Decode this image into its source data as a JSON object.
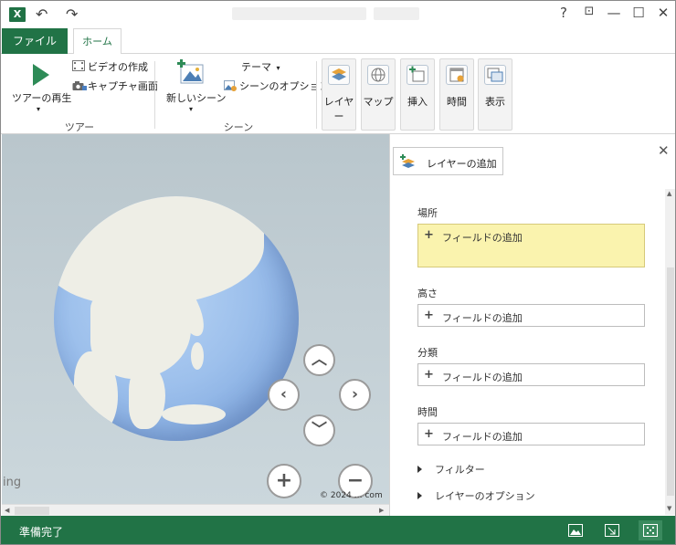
{
  "titlebar": {
    "app_icon_label": "X",
    "help": "?",
    "restore_ribbon": "⊡",
    "minimize": "—",
    "maximize": "☐",
    "close": "✕"
  },
  "tabs": {
    "file": "ファイル",
    "home": "ホーム"
  },
  "ribbon": {
    "tour": {
      "play_label": "ツアーの再生",
      "create_video_label": "ビデオの作成",
      "capture_screen_label": "キャプチャ画面",
      "group_label": "ツアー"
    },
    "scene": {
      "new_scene_label": "新しいシーン",
      "theme_label": "テーマ",
      "scene_options_label": "シーンのオプション",
      "group_label": "シーン"
    },
    "tiles": [
      {
        "label": "レイヤー",
        "icon": "layers-icon"
      },
      {
        "label": "マップ",
        "icon": "globe-icon"
      },
      {
        "label": "挿入",
        "icon": "insert-icon"
      },
      {
        "label": "時間",
        "icon": "calendar-icon"
      },
      {
        "label": "表示",
        "icon": "view-icon"
      }
    ]
  },
  "map": {
    "brand_fragment": "ing",
    "copyright": "© 2024 … com"
  },
  "pane": {
    "add_layer_label": "レイヤーの追加",
    "close": "✕",
    "fields": [
      {
        "label": "場所",
        "add": "フィールドの追加"
      },
      {
        "label": "高さ",
        "add": "フィールドの追加"
      },
      {
        "label": "分類",
        "add": "フィールドの追加"
      },
      {
        "label": "時間",
        "add": "フィールドの追加"
      }
    ],
    "filter_label": "フィルター",
    "layer_options_label": "レイヤーのオプション"
  },
  "status": {
    "text": "準備完了"
  },
  "colors": {
    "accent_green": "#217346",
    "location_field_highlight": "#faf3ae"
  }
}
